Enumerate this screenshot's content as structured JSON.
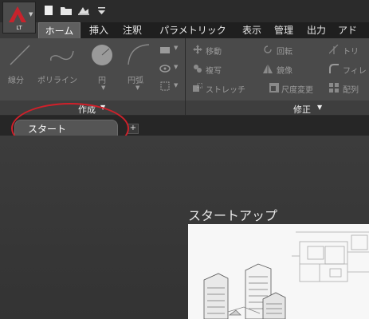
{
  "app": {
    "badge_text": "LT",
    "accent_color": "#c8232c"
  },
  "quick_access": [
    "new-file-icon",
    "open-folder-icon",
    "save-icon",
    "dropdown-arrow-icon"
  ],
  "ribbon_tabs": [
    {
      "label": "ホーム",
      "active": true
    },
    {
      "label": "挿入"
    },
    {
      "label": "注釈"
    },
    {
      "label": "パラメトリック"
    },
    {
      "label": "表示"
    },
    {
      "label": "管理"
    },
    {
      "label": "出力"
    },
    {
      "label": "アド"
    }
  ],
  "panels": {
    "draw": {
      "title": "作成",
      "tools": {
        "line": "線分",
        "polyline": "ポリライン",
        "circle": "円",
        "arc": "円弧"
      }
    },
    "modify": {
      "title": "修正",
      "tools": {
        "move": "移動",
        "rotate": "回転",
        "trim": "トリ",
        "copy": "複写",
        "mirror": "鏡像",
        "fillet": "フィレ",
        "stretch": "ストレッチ",
        "scale": "尺度変更",
        "array": "配列"
      }
    }
  },
  "file_tabs": {
    "active": "スタート",
    "add_symbol": "+"
  },
  "start_page": {
    "title": "スタートアップ"
  }
}
